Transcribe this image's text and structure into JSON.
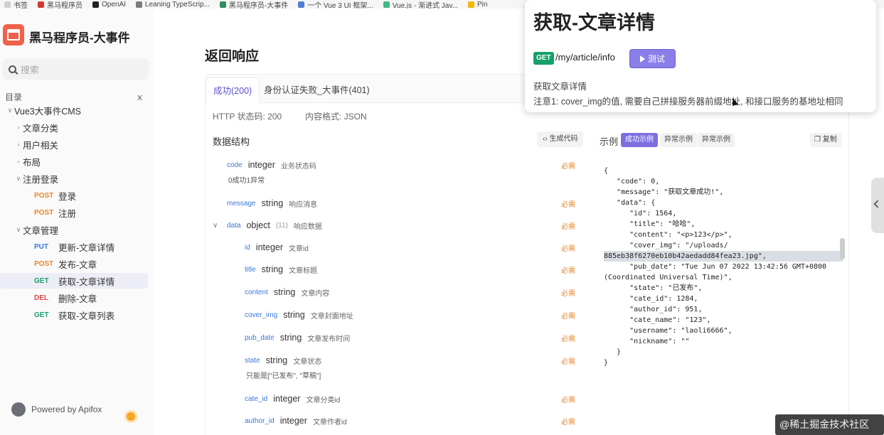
{
  "bookmarks": [
    {
      "label": "书签",
      "color": "#cfcfcf"
    },
    {
      "label": "黑马程序员",
      "color": "#d13b2e"
    },
    {
      "label": "OpenAI",
      "color": "#222222"
    },
    {
      "label": "Leaning TypeScrip...",
      "color": "#7b7b7b"
    },
    {
      "label": "黑马程序员-大事件",
      "color": "#2f8d5e"
    },
    {
      "label": "一个 Vue 3 UI 框架...",
      "color": "#4f7fd0"
    },
    {
      "label": "Vue.js - 渐进式 Jav...",
      "color": "#42b883"
    },
    {
      "label": "Pin",
      "color": "#f2b705"
    }
  ],
  "sidebar": {
    "app_name": "黑马程序员-大事件",
    "search_placeholder": "搜索",
    "toc_label": "目录",
    "toc_close": "ｘ",
    "items": [
      {
        "label": "Vue3大事件CMS",
        "level": 0,
        "chev": "∨",
        "method": ""
      },
      {
        "label": "文章分类",
        "level": 1,
        "chev": "›",
        "method": ""
      },
      {
        "label": "用户相关",
        "level": 1,
        "chev": "›",
        "method": ""
      },
      {
        "label": "布局",
        "level": 1,
        "chev": "›",
        "method": ""
      },
      {
        "label": "注册登录",
        "level": 1,
        "chev": "∨",
        "method": ""
      },
      {
        "label": "登录",
        "level": 2,
        "chev": "",
        "method": "POST"
      },
      {
        "label": "注册",
        "level": 2,
        "chev": "",
        "method": "POST"
      },
      {
        "label": "文章管理",
        "level": 1,
        "chev": "∨",
        "method": ""
      },
      {
        "label": "更新-文章详情",
        "level": 2,
        "chev": "",
        "method": "PUT"
      },
      {
        "label": "发布-文章",
        "level": 2,
        "chev": "",
        "method": "POST"
      },
      {
        "label": "获取-文章详情",
        "level": 2,
        "chev": "",
        "method": "GET",
        "active": true
      },
      {
        "label": "删除-文章",
        "level": 2,
        "chev": "",
        "method": "DEL"
      },
      {
        "label": "获取-文章列表",
        "level": 2,
        "chev": "",
        "method": "GET"
      }
    ],
    "powered": "Powered by Apifox"
  },
  "main": {
    "heading": "返回响应",
    "tabs": [
      "成功(200)",
      "身份认证失败_大事件(401)"
    ],
    "http_status": "HTTP 状态码: 200",
    "content_type": "内容格式: JSON",
    "data_structure": "数据结构",
    "gen_code": "‹› 生成代码",
    "example_label": "示例",
    "example_buttons": [
      "成功示例",
      "异常示例",
      "异常示例"
    ],
    "copy": "❐ 复制",
    "fields": [
      {
        "name": "code",
        "type": "integer",
        "desc": "业务状态码",
        "note": "0成功1异常"
      },
      {
        "name": "message",
        "type": "string",
        "desc": "响应消息"
      },
      {
        "name": "data",
        "type": "object",
        "count": "(11)",
        "desc": "响应数据",
        "expand": "∨"
      },
      {
        "name": "id",
        "type": "integer",
        "desc": "文章id"
      },
      {
        "name": "title",
        "type": "string",
        "desc": "文章标题"
      },
      {
        "name": "content",
        "type": "string",
        "desc": "文章内容"
      },
      {
        "name": "cover_img",
        "type": "string",
        "desc": "文章封面地址"
      },
      {
        "name": "pub_date",
        "type": "string",
        "desc": "文章发布时间"
      },
      {
        "name": "state",
        "type": "string",
        "desc": "文章状态",
        "note": "只能是[\"已发布\", \"草稿\"]"
      },
      {
        "name": "cate_id",
        "type": "integer",
        "desc": "文章分类id"
      },
      {
        "name": "author_id",
        "type": "integer",
        "desc": "文章作者id"
      }
    ],
    "required": "必需",
    "code_lines": [
      "{",
      "   \"code\": 0,",
      "   \"message\": \"获取文章成功!\",",
      "   \"data\": {",
      "      \"id\": 1564,",
      "      \"title\": \"哈哈\",",
      "      \"content\": \"<p>123</p>\",",
      "      \"cover_img\": \"/uploads/",
      "885eb38f6270eb10b42aedadd84fea23.jpg\",",
      "      \"pub_date\": \"Tue Jun 07 2022 13:42:56 GMT+0800",
      "(Coordinated Universal Time)\",",
      "      \"state\": \"已发布\",",
      "      \"cate_id\": 1284,",
      "      \"author_id\": 951,",
      "      \"cate_name\": \"123\",",
      "      \"username\": \"laoli6666\",",
      "      \"nickname\": \"\"",
      "   }",
      "}"
    ]
  },
  "popup": {
    "title": "获取-文章详情",
    "method": "GET",
    "path": "/my/article/info",
    "test_label": "测试",
    "desc": "获取文章详情",
    "note": "注意1: cover_img的值, 需要自己拼接服务器前缀地址, 和接口服务的基地址相同"
  },
  "watermark": "@稀土掘金技术社区"
}
